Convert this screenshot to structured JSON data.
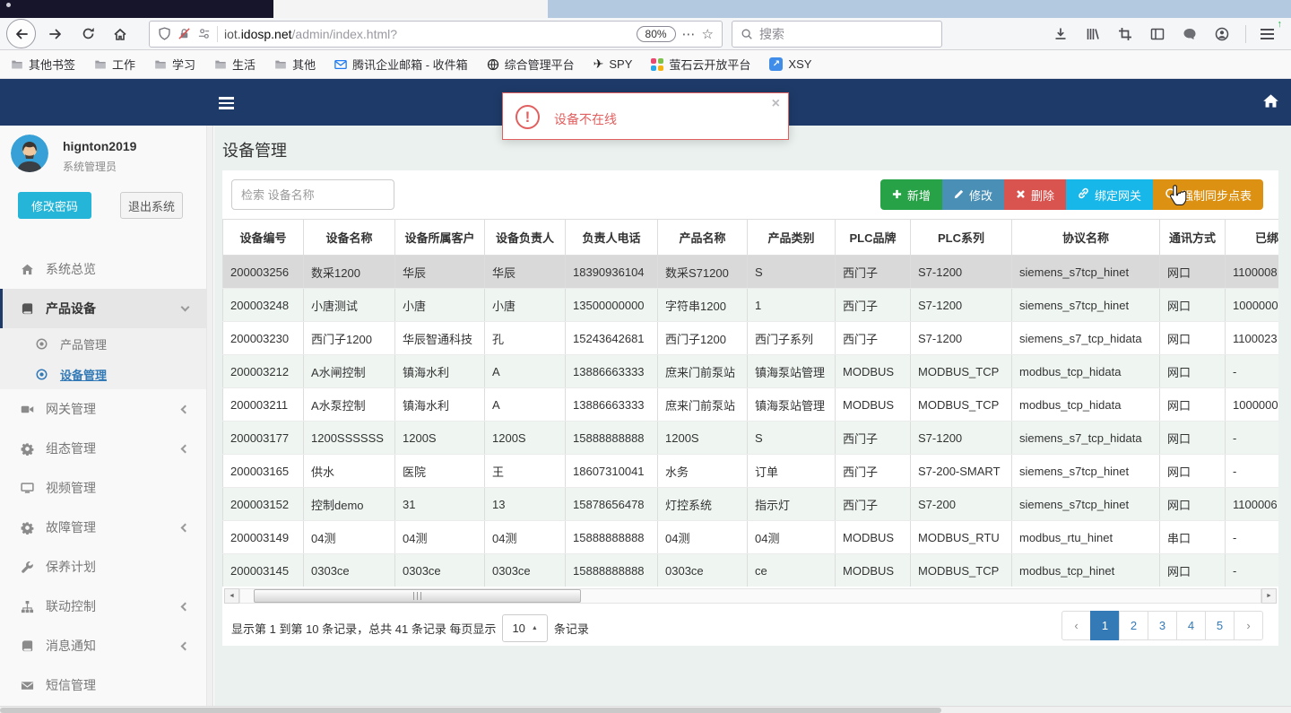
{
  "glyphs": {
    "more": "⋯",
    "star": "☆",
    "plane": "✈",
    "arrow_up_right": "↗",
    "caret_up": "▲",
    "scroll_left": "◄",
    "scroll_right": "►",
    "close": "×",
    "exclamation": "!",
    "update_arrow": "↑"
  },
  "colors": {
    "header_navy": "#1e3a68",
    "link_blue": "#337ab7",
    "alert_red": "#e15f5f",
    "password_button_cyan": "#24b5d8",
    "row_selected_gray": "#d9d9d9",
    "row_stripe_mint": "#eff6f2"
  },
  "browser": {
    "toolbar": {
      "url_subdomain": "iot.",
      "url_domain": "idosp.net",
      "url_path": "/admin/index.html?",
      "zoom_badge": "80%",
      "search_placeholder": "搜索"
    },
    "bookmarks": [
      {
        "label": "其他书签",
        "icon": "folder-icon"
      },
      {
        "label": "工作",
        "icon": "folder-icon"
      },
      {
        "label": "学习",
        "icon": "folder-icon"
      },
      {
        "label": "生活",
        "icon": "folder-icon"
      },
      {
        "label": "其他",
        "icon": "folder-icon"
      },
      {
        "label": "腾讯企业邮箱 - 收件箱",
        "icon": "mail-icon"
      },
      {
        "label": "综合管理平台",
        "icon": "globe-icon"
      },
      {
        "label": "SPY",
        "icon": "plane-icon"
      },
      {
        "label": "萤石云开放平台",
        "icon": "dots-icon"
      },
      {
        "label": "XSY",
        "icon": "arrow-app-icon"
      }
    ]
  },
  "app": {
    "alert": {
      "message": "设备不在线",
      "close_glyph": "×"
    },
    "page_title": "设备管理",
    "sidebar": {
      "username": "hignton2019",
      "role": "系统管理员",
      "change_password_label": "修改密码",
      "logout_label": "退出系统",
      "menu": [
        {
          "name": "overview",
          "label": "系统总览",
          "icon": "home-icon"
        },
        {
          "name": "product-device",
          "label": "产品设备",
          "icon": "book-icon",
          "expanded": true,
          "active_parent": true
        },
        {
          "name": "product-mgmt",
          "label": "产品管理",
          "icon": "dot-circle-icon",
          "sub": true
        },
        {
          "name": "device-mgmt",
          "label": "设备管理",
          "icon": "dot-circle-icon",
          "sub": true,
          "current": true
        },
        {
          "name": "gateway-mgmt",
          "label": "网关管理",
          "icon": "video-icon",
          "collapsed": true
        },
        {
          "name": "config-mgmt",
          "label": "组态管理",
          "icon": "gears-icon",
          "collapsed": true
        },
        {
          "name": "video-mgmt",
          "label": "视频管理",
          "icon": "monitor-icon"
        },
        {
          "name": "fault-mgmt",
          "label": "故障管理",
          "icon": "gears-icon",
          "collapsed": true
        },
        {
          "name": "maintenance-plan",
          "label": "保养计划",
          "icon": "wrench-icon"
        },
        {
          "name": "linkage-control",
          "label": "联动控制",
          "icon": "sitemap-icon",
          "collapsed": true
        },
        {
          "name": "message-notice",
          "label": "消息通知",
          "icon": "book-icon",
          "collapsed": true
        },
        {
          "name": "sms-mgmt",
          "label": "短信管理",
          "icon": "envelope-icon"
        }
      ]
    },
    "toolbar": {
      "search_placeholder": "检索 设备名称",
      "buttons": [
        {
          "name": "add",
          "label": "新增",
          "icon": "plus-icon",
          "color": "#27a246"
        },
        {
          "name": "edit",
          "label": "修改",
          "icon": "pencil-icon",
          "color": "#4a8fb5"
        },
        {
          "name": "delete",
          "label": "删除",
          "icon": "cross-icon",
          "color": "#d9534f"
        },
        {
          "name": "bind-gateway",
          "label": "绑定网关",
          "icon": "link-icon",
          "color": "#17b7ea"
        },
        {
          "name": "force-sync",
          "label": "强制同步点表",
          "icon": "refresh-icon",
          "color": "#dd9113"
        }
      ]
    },
    "table": {
      "columns": [
        "设备编号",
        "设备名称",
        "设备所属客户",
        "设备负责人",
        "负责人电话",
        "产品名称",
        "产品类别",
        "PLC品牌",
        "PLC系列",
        "协议名称",
        "通讯方式",
        "已绑定网关"
      ],
      "rows": [
        {
          "selected": true,
          "cells": [
            "200003256",
            "数采1200",
            "华辰",
            "华辰",
            "18390936104",
            "数采S71200",
            "S",
            "西门子",
            "S7-1200",
            "siemens_s7tcp_hinet",
            "网口",
            "1100008"
          ]
        },
        {
          "cells": [
            "200003248",
            "小唐测试",
            "小唐",
            "小唐",
            "13500000000",
            "字符串1200",
            "1",
            "西门子",
            "S7-1200",
            "siemens_s7tcp_hinet",
            "网口",
            "1000000"
          ]
        },
        {
          "cells": [
            "200003230",
            "西门子1200",
            "华辰智通科技",
            "孔",
            "15243642681",
            "西门子1200",
            "西门子系列",
            "西门子",
            "S7-1200",
            "siemens_s7_tcp_hidata",
            "网口",
            "1100023"
          ]
        },
        {
          "cells": [
            "200003212",
            "A水闸控制",
            "镇海水利",
            "A",
            "13886663333",
            "庶来门前泵站",
            "镇海泵站管理",
            "MODBUS",
            "MODBUS_TCP",
            "modbus_tcp_hidata",
            "网口",
            "-"
          ]
        },
        {
          "cells": [
            "200003211",
            "A水泵控制",
            "镇海水利",
            "A",
            "13886663333",
            "庶来门前泵站",
            "镇海泵站管理",
            "MODBUS",
            "MODBUS_TCP",
            "modbus_tcp_hidata",
            "网口",
            "1000000"
          ]
        },
        {
          "cells": [
            "200003177",
            "1200SSSSSS",
            "1200S",
            "1200S",
            "15888888888",
            "1200S",
            "S",
            "西门子",
            "S7-1200",
            "siemens_s7_tcp_hidata",
            "网口",
            "-"
          ]
        },
        {
          "cells": [
            "200003165",
            "供水",
            "医院",
            "王",
            "18607310041",
            "水务",
            "订单",
            "西门子",
            "S7-200-SMART",
            "siemens_s7tcp_hinet",
            "网口",
            "-"
          ]
        },
        {
          "cells": [
            "200003152",
            "控制demo",
            "31",
            "13",
            "15878656478",
            "灯控系统",
            "指示灯",
            "西门子",
            "S7-200",
            "siemens_s7tcp_hinet",
            "网口",
            "1100006"
          ]
        },
        {
          "cells": [
            "200003149",
            "04测",
            "04测",
            "04测",
            "15888888888",
            "04测",
            "04测",
            "MODBUS",
            "MODBUS_RTU",
            "modbus_rtu_hinet",
            "串口",
            "-"
          ]
        },
        {
          "cells": [
            "200003145",
            "0303ce",
            "0303ce",
            "0303ce",
            "15888888888",
            "0303ce",
            "ce",
            "MODBUS",
            "MODBUS_TCP",
            "modbus_tcp_hinet",
            "网口",
            "-"
          ]
        }
      ]
    },
    "pagination": {
      "summary_prefix": "显示第 1 到第 10 条记录，总共 41 条记录 每页显示",
      "page_size": "10",
      "summary_suffix": "条记录",
      "prev": "‹",
      "next": "›",
      "pages": [
        "1",
        "2",
        "3",
        "4",
        "5"
      ],
      "active_page": "1"
    }
  }
}
